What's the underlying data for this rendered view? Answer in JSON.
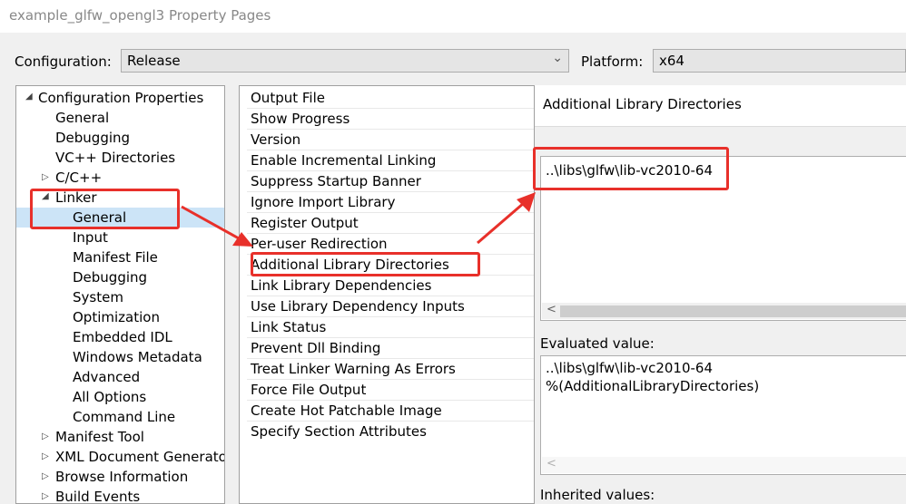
{
  "window": {
    "title": "example_glfw_opengl3 Property Pages"
  },
  "config": {
    "configuration_label": "Configuration:",
    "configuration_value": "Release",
    "platform_label": "Platform:",
    "platform_value": "x64"
  },
  "tree": {
    "root": "Configuration Properties",
    "general": "General",
    "debugging": "Debugging",
    "vc_dirs": "VC++ Directories",
    "cpp": "C/C++",
    "linker": "Linker",
    "linker_children": [
      "General",
      "Input",
      "Manifest File",
      "Debugging",
      "System",
      "Optimization",
      "Embedded IDL",
      "Windows Metadata",
      "Advanced",
      "All Options",
      "Command Line"
    ],
    "manifest_tool": "Manifest Tool",
    "xml_doc": "XML Document Generato",
    "browse_info": "Browse Information",
    "build_events": "Build Events"
  },
  "properties": [
    "Output File",
    "Show Progress",
    "Version",
    "Enable Incremental Linking",
    "Suppress Startup Banner",
    "Ignore Import Library",
    "Register Output",
    "Per-user Redirection",
    "Additional Library Directories",
    "Link Library Dependencies",
    "Use Library Dependency Inputs",
    "Link Status",
    "Prevent Dll Binding",
    "Treat Linker Warning As Errors",
    "Force File Output",
    "Create Hot Patchable Image",
    "Specify Section Attributes"
  ],
  "editor": {
    "heading": "Additional Library Directories",
    "value": "..\\libs\\glfw\\lib-vc2010-64",
    "evaluated_label": "Evaluated value:",
    "evaluated_line1": "..\\libs\\glfw\\lib-vc2010-64",
    "evaluated_line2": "%(AdditionalLibraryDirectories)",
    "inherited_label": "Inherited values:"
  },
  "colors": {
    "highlight": "#e8302a",
    "selection": "#cce4f7"
  }
}
